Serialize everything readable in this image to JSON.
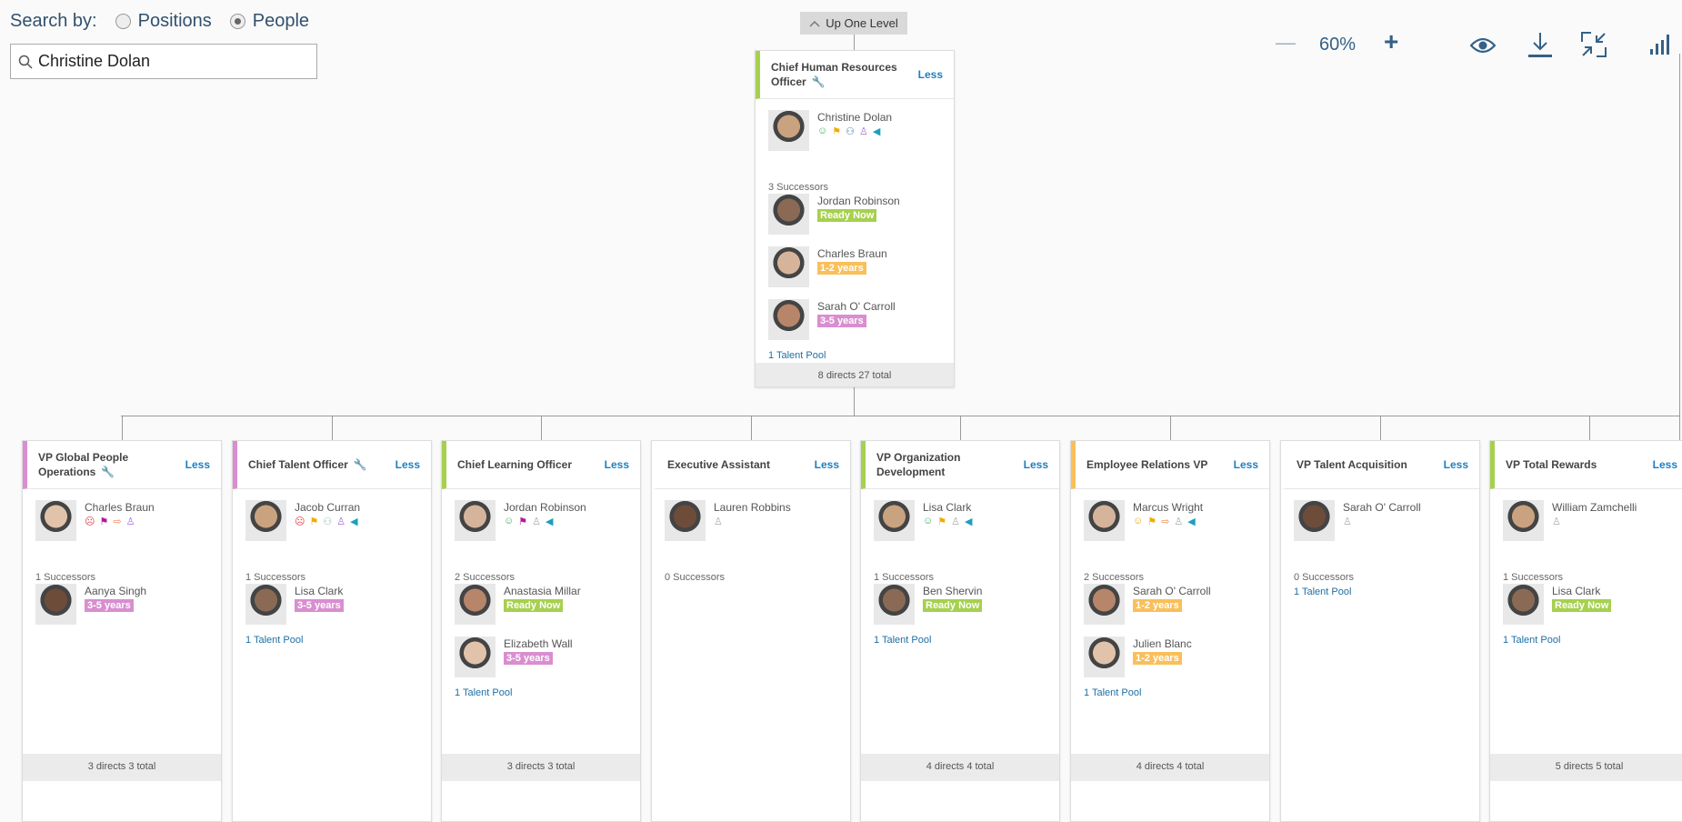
{
  "search": {
    "label": "Search by:",
    "options": [
      "Positions",
      "People"
    ],
    "selected": "People",
    "value": "Christine Dolan"
  },
  "up_level": "Up One Level",
  "toolbar": {
    "zoom": "60%",
    "icons": [
      "minus-icon",
      "plus-icon",
      "eye-icon",
      "download-icon",
      "collapse-icon",
      "chart-icon"
    ]
  },
  "colors": {
    "ready_now": "#a6d04f",
    "1-2 years": "#f9bf5a",
    "3-5 years": "#d98ed0",
    "link": "#1d7fc1",
    "toolbar": "#346187"
  },
  "top": {
    "title": "Chief Human Resources Officer",
    "key": true,
    "stripe": "#a6d04f",
    "less": "Less",
    "person": "Christine Dolan",
    "icons": [
      "smile",
      "flag-orange",
      "network",
      "person-purple",
      "megaphone"
    ],
    "successors_label": "3 Successors",
    "successors": [
      {
        "name": "Jordan Robinson",
        "readiness": "Ready Now"
      },
      {
        "name": "Charles Braun",
        "readiness": "1-2 years"
      },
      {
        "name": "Sarah O' Carroll",
        "readiness": "3-5 years"
      }
    ],
    "pool": "1 Talent Pool",
    "footer": "8 directs 27 total"
  },
  "cards": [
    {
      "title": "VP Global People Operations",
      "key": true,
      "stripe": "#d98ed0",
      "less": "Less",
      "person": "Charles Braun",
      "icons": [
        "frown",
        "flag-magenta",
        "exit",
        "person-purple"
      ],
      "successors_label": "1 Successors",
      "successors": [
        {
          "name": "Aanya Singh",
          "readiness": "3-5 years"
        }
      ],
      "pool": "",
      "footer": "3 directs 3 total"
    },
    {
      "title": "Chief Talent Officer",
      "key": true,
      "stripe": "#d98ed0",
      "less": "Less",
      "person": "Jacob Curran",
      "icons": [
        "frown",
        "flag-orange",
        "network-gray",
        "person-purple",
        "megaphone"
      ],
      "successors_label": "1 Successors",
      "successors": [
        {
          "name": "Lisa Clark",
          "readiness": "3-5 years"
        }
      ],
      "pool": "1 Talent Pool",
      "footer": ""
    },
    {
      "title": "Chief Learning Officer",
      "key": false,
      "stripe": "#a6d04f",
      "less": "Less",
      "person": "Jordan Robinson",
      "icons": [
        "smile",
        "flag-magenta",
        "person-gray",
        "megaphone"
      ],
      "successors_label": "2 Successors",
      "successors": [
        {
          "name": "Anastasia Millar",
          "readiness": "Ready Now"
        },
        {
          "name": "Elizabeth Wall",
          "readiness": "3-5 years"
        }
      ],
      "pool": "1 Talent Pool",
      "footer": "3 directs 3 total"
    },
    {
      "title": "Executive Assistant",
      "key": false,
      "stripe": "",
      "less": "Less",
      "person": "Lauren Robbins",
      "icons": [
        "person-gray"
      ],
      "successors_label": "0 Successors",
      "successors": [],
      "pool": "",
      "footer": ""
    },
    {
      "title": "VP Organization Development",
      "key": false,
      "stripe": "#a6d04f",
      "less": "Less",
      "person": "Lisa Clark",
      "icons": [
        "smile",
        "flag-orange",
        "person-gray",
        "megaphone"
      ],
      "successors_label": "1 Successors",
      "successors": [
        {
          "name": "Ben Shervin",
          "readiness": "Ready Now"
        }
      ],
      "pool": "1 Talent Pool",
      "footer": "4 directs 4 total"
    },
    {
      "title": "Employee Relations VP",
      "key": false,
      "stripe": "#f9bf5a",
      "less": "Less",
      "person": "Marcus Wright",
      "icons": [
        "neutral",
        "flag-orange",
        "exit",
        "person-gray",
        "megaphone"
      ],
      "successors_label": "2 Successors",
      "successors": [
        {
          "name": "Sarah O' Carroll",
          "readiness": "1-2 years"
        },
        {
          "name": "Julien Blanc",
          "readiness": "1-2 years"
        }
      ],
      "pool": "1 Talent Pool",
      "footer": "4 directs 4 total"
    },
    {
      "title": "VP Talent Acquisition",
      "key": false,
      "stripe": "",
      "less": "Less",
      "person": "Sarah O' Carroll",
      "icons": [
        "person-gray"
      ],
      "successors_label": "0 Successors",
      "successors": [],
      "pool": "1 Talent Pool",
      "footer": ""
    },
    {
      "title": "VP Total Rewards",
      "key": false,
      "stripe": "#a6d04f",
      "less": "Less",
      "person": "William Zamchelli",
      "icons": [
        "person-gray"
      ],
      "successors_label": "1 Successors",
      "successors": [
        {
          "name": "Lisa Clark",
          "readiness": "Ready Now"
        }
      ],
      "pool": "1 Talent Pool",
      "footer": "5 directs 5 total"
    }
  ]
}
